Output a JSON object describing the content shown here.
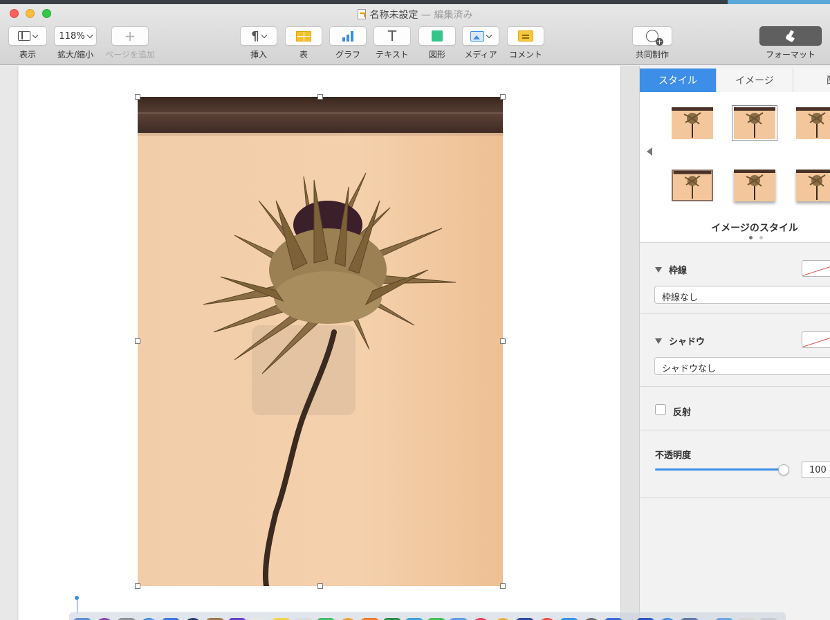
{
  "window": {
    "title": "名称未設定",
    "edited_suffix": "— 編集済み"
  },
  "toolbar": {
    "view": {
      "label": "表示"
    },
    "zoom": {
      "label": "拡大/縮小",
      "value": "118%"
    },
    "add_page": {
      "label": "ページを追加"
    },
    "insert": {
      "label": "挿入"
    },
    "table": {
      "label": "表"
    },
    "chart": {
      "label": "グラフ"
    },
    "text": {
      "label": "テキスト"
    },
    "shape": {
      "label": "図形"
    },
    "media": {
      "label": "メディア"
    },
    "comment": {
      "label": "コメント"
    },
    "collaborate": {
      "label": "共同制作"
    },
    "format": {
      "label": "フォーマット"
    }
  },
  "inspector": {
    "tabs": [
      {
        "label": "スタイル",
        "active": true
      },
      {
        "label": "イメージ",
        "active": false
      },
      {
        "label": "配",
        "active": false
      }
    ],
    "styles_caption": "イメージのスタイル",
    "border": {
      "title": "枠線",
      "value": "枠線なし"
    },
    "shadow": {
      "title": "シャドウ",
      "value": "シャドウなし"
    },
    "reflection": {
      "label": "反射",
      "checked": false
    },
    "opacity": {
      "title": "不透明度",
      "value": "100",
      "fraction": 1.0
    }
  },
  "colors": {
    "accent": "#3d8ee6",
    "close": "#fc605c",
    "minimize": "#fdbc40",
    "zoom": "#34c84a"
  }
}
